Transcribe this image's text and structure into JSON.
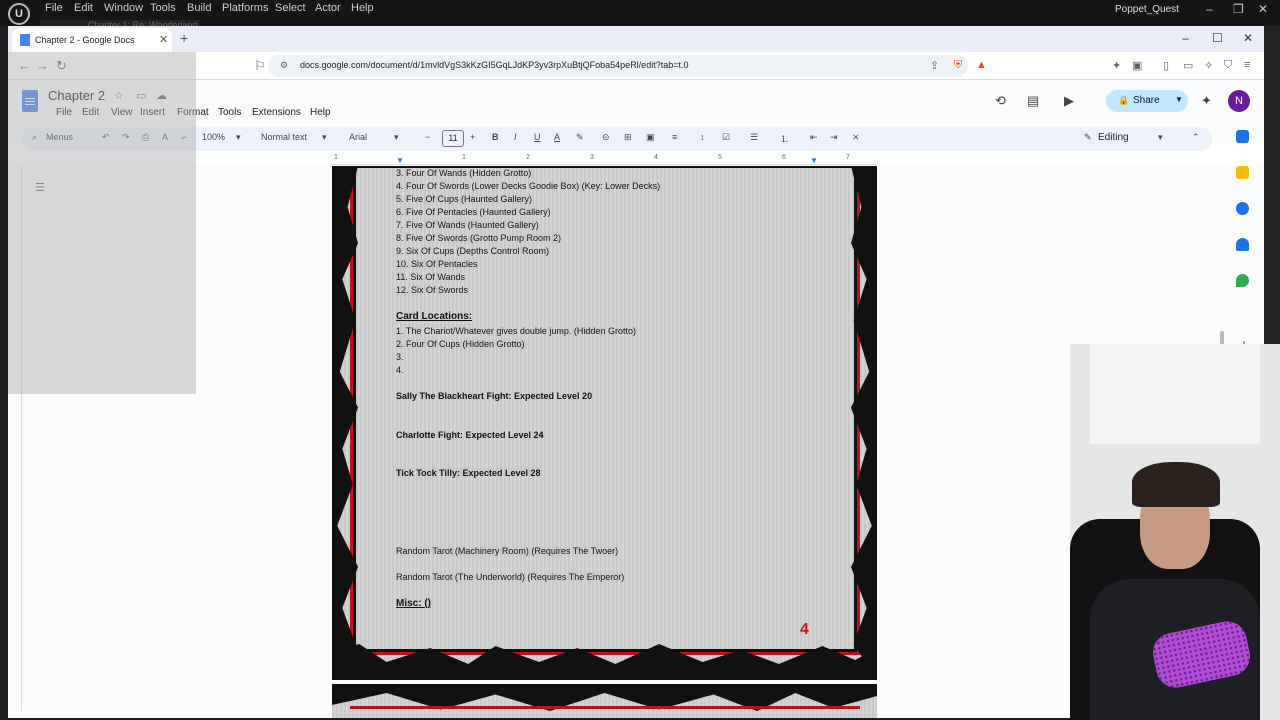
{
  "ue": {
    "menu": [
      "File",
      "Edit",
      "Window",
      "Tools",
      "Build",
      "Platforms",
      "Select",
      "Actor",
      "Help"
    ],
    "project": "Poppet_Quest",
    "subtab": "Chapter 1: Re: Wonderland"
  },
  "browser": {
    "tab_title": "Chapter 2 - Google Docs",
    "url": "docs.google.com/document/d/1mvldVgS3kKzGI5GqLJdKP3yv3rpXuBtjQFoba54peRl/edit?tab=t.0"
  },
  "docs": {
    "title": "Chapter 2",
    "menu": [
      "File",
      "Edit",
      "View",
      "Insert",
      "Format",
      "Tools",
      "Extensions",
      "Help"
    ],
    "share_label": "Share",
    "avatar_letter": "N",
    "toolbar": {
      "search_menus": "Menus",
      "zoom": "100%",
      "style": "Normal text",
      "font": "Arial",
      "font_size": "11",
      "mode": "Editing"
    },
    "ruler_ticks": [
      "1",
      "1",
      "2",
      "3",
      "4",
      "5",
      "6",
      "7"
    ]
  },
  "document": {
    "lines": [
      "3. Four Of Wands (Hidden Grotto)",
      "4. Four Of Swords (Lower Decks Goodie Box) (Key: Lower Decks)",
      "5. Five Of Cups (Haunted Gallery)",
      "6. Five Of Pentacles (Haunted Gallery)",
      "7. Five Of Wands (Haunted Gallery)",
      "8. Five Of Swords (Grotto Pump Room 2)",
      "9. Six Of Cups (Depths Control Room)",
      "10. Six Of Pentacles",
      "11. Six Of Wands",
      "12. Six Of Swords"
    ],
    "card_locations_heading": "Card Locations:",
    "card_locations": [
      "1. The Chariot/Whatever gives double jump. (Hidden Grotto)",
      "2. Four Of Cups (Hidden Grotto)",
      "3.",
      "4."
    ],
    "fights": [
      "Sally The Blackheart Fight: Expected Level 20",
      "Charlotte Fight: Expected Level 24",
      "Tick Tock Tilly: Expected Level 28"
    ],
    "random_tarots": [
      "Random Tarot (Machinery Room) (Requires The Twoer)",
      "Random Tarot (The Underworld) (Requires The Emperor)"
    ],
    "misc_heading": "Misc: ()",
    "page_number": "4"
  }
}
